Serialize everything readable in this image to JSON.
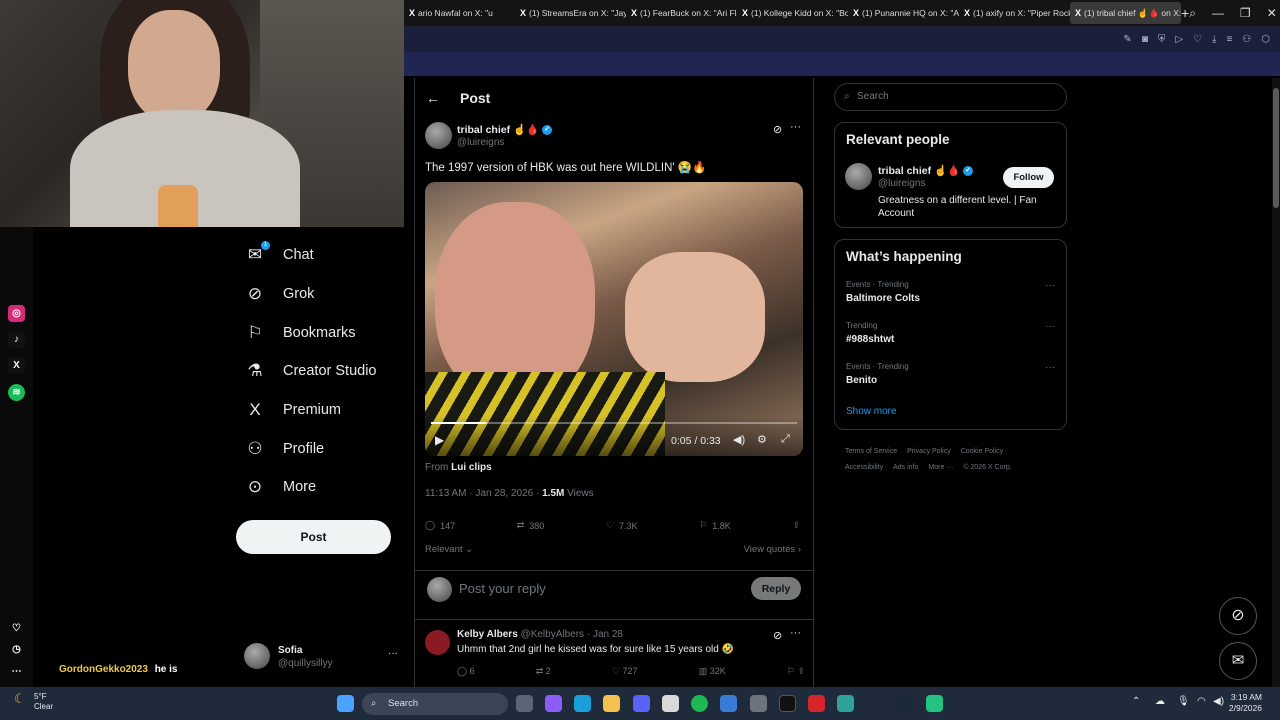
{
  "browser": {
    "tabs": [
      {
        "label": "ario Nawfal on X: \"u"
      },
      {
        "label": "(1) StreamsEra on X: \"Jay"
      },
      {
        "label": "(1) FearBuck on X: \"Ari Fle"
      },
      {
        "label": "(1) Kollege Kidd on X: \"Bo"
      },
      {
        "label": "(1) Punannie HQ on X: \"A"
      },
      {
        "label": "(1) axify on X: \"Piper Rock"
      },
      {
        "label": "(1) tribal chief ☝️🩸 on X: \""
      }
    ],
    "new_tab": "+"
  },
  "stream": {
    "chat_user": "GordonGekko2023",
    "chat_text": "he is"
  },
  "nav": {
    "items": [
      {
        "label": "Chat",
        "icon": "mail-icon",
        "badge": "1"
      },
      {
        "label": "Grok",
        "icon": "grok-icon"
      },
      {
        "label": "Bookmarks",
        "icon": "bookmark-icon"
      },
      {
        "label": "Creator Studio",
        "icon": "flask-icon"
      },
      {
        "label": "Premium",
        "icon": "x-logo-icon"
      },
      {
        "label": "Profile",
        "icon": "person-icon"
      },
      {
        "label": "More",
        "icon": "more-circle-icon"
      }
    ],
    "post_button": "Post",
    "account": {
      "name": "Sofia",
      "handle": "@quillysillyy",
      "more": "···"
    }
  },
  "post": {
    "header": "Post",
    "author": "tribal chief ☝️🩸",
    "handle": "@luireigns",
    "text": "The 1997 version of HBK was out here WILDLIN' 😭🔥",
    "video": {
      "time": "0:05 / 0:33",
      "progress": 0.15
    },
    "from_label": "From",
    "from_source": "Lui clips",
    "timestamp": "11:13 AM · Jan 28, 2026 · ",
    "views_count": "1.5M",
    "views_label": "Views",
    "stats": {
      "replies": "147",
      "reposts": "380",
      "likes": "7.3K",
      "bookmarks": "1.8K"
    },
    "sort_label": "Relevant",
    "view_quotes": "View quotes",
    "reply_placeholder": "Post your reply",
    "reply_button": "Reply"
  },
  "comment": {
    "author": "Kelby Albers",
    "handle": "@KelbyAlbers · Jan 28",
    "text": "Uhmm that 2nd girl he kissed was for sure like 15 years old 🤣",
    "stats": {
      "replies": "6",
      "reposts": "2",
      "likes": "727",
      "views": "32K"
    }
  },
  "sidebar": {
    "search_placeholder": "Search",
    "relevant_title": "Relevant people",
    "person": {
      "name": "tribal chief ☝️🩸",
      "handle": "@luireigns",
      "bio": "Greatness on a different level. | Fan Account",
      "follow": "Follow"
    },
    "happening_title": "What’s happening",
    "trends": [
      {
        "category": "Events · Trending",
        "name": "Baltimore Colts"
      },
      {
        "category": "Trending",
        "name": "#988shtwt"
      },
      {
        "category": "Events · Trending",
        "name": "Benito"
      }
    ],
    "show_more": "Show more",
    "footer": [
      "Terms of Service",
      "Privacy Policy",
      "Cookie Policy",
      "Accessibility",
      "Ads info",
      "More ···",
      "© 2026 X Corp."
    ]
  },
  "taskbar": {
    "temp": "5°F",
    "condition": "Clear",
    "search": "Search",
    "time": "3:19 AM",
    "date": "2/9/2026"
  },
  "colors": {
    "accent": "#1d9bf0",
    "background": "#000000",
    "toolbar": "#1b1f3a"
  }
}
